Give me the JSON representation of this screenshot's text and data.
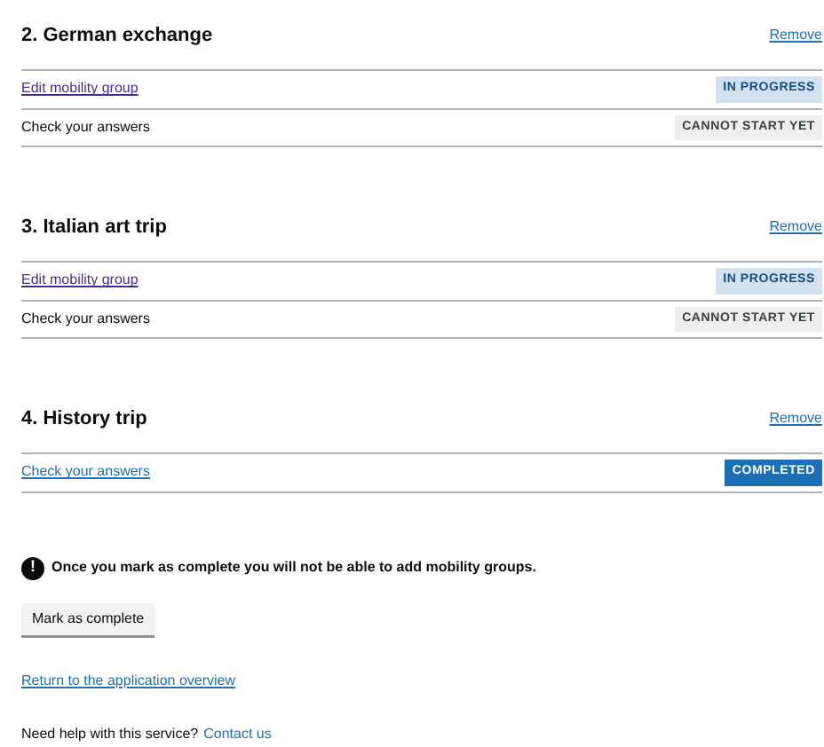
{
  "groups": [
    {
      "title": "2. German exchange",
      "remove": "Remove",
      "tasks": [
        {
          "label": "Edit mobility group",
          "kind": "visited_link",
          "status": {
            "text": "IN PROGRESS",
            "kind": "in_progress"
          }
        },
        {
          "label": "Check your answers",
          "kind": "text",
          "status": {
            "text": "CANNOT START YET",
            "kind": "cannot_start"
          }
        }
      ]
    },
    {
      "title": "3. Italian art trip",
      "remove": "Remove",
      "tasks": [
        {
          "label": "Edit mobility group",
          "kind": "visited_link",
          "status": {
            "text": "IN PROGRESS",
            "kind": "in_progress"
          }
        },
        {
          "label": "Check your answers",
          "kind": "text",
          "status": {
            "text": "CANNOT START YET",
            "kind": "cannot_start"
          }
        }
      ]
    },
    {
      "title": "4. History trip",
      "remove": "Remove",
      "tasks": [
        {
          "label": "Check your answers",
          "kind": "link",
          "status": {
            "text": "COMPLETED",
            "kind": "completed"
          }
        }
      ]
    }
  ],
  "warning": {
    "icon": "!",
    "text": "Once you mark as complete you will not be able to add mobility groups."
  },
  "button": "Mark as complete",
  "return_link": "Return to the application overview",
  "help": {
    "text": "Need help with this service?",
    "link": "Contact us"
  }
}
